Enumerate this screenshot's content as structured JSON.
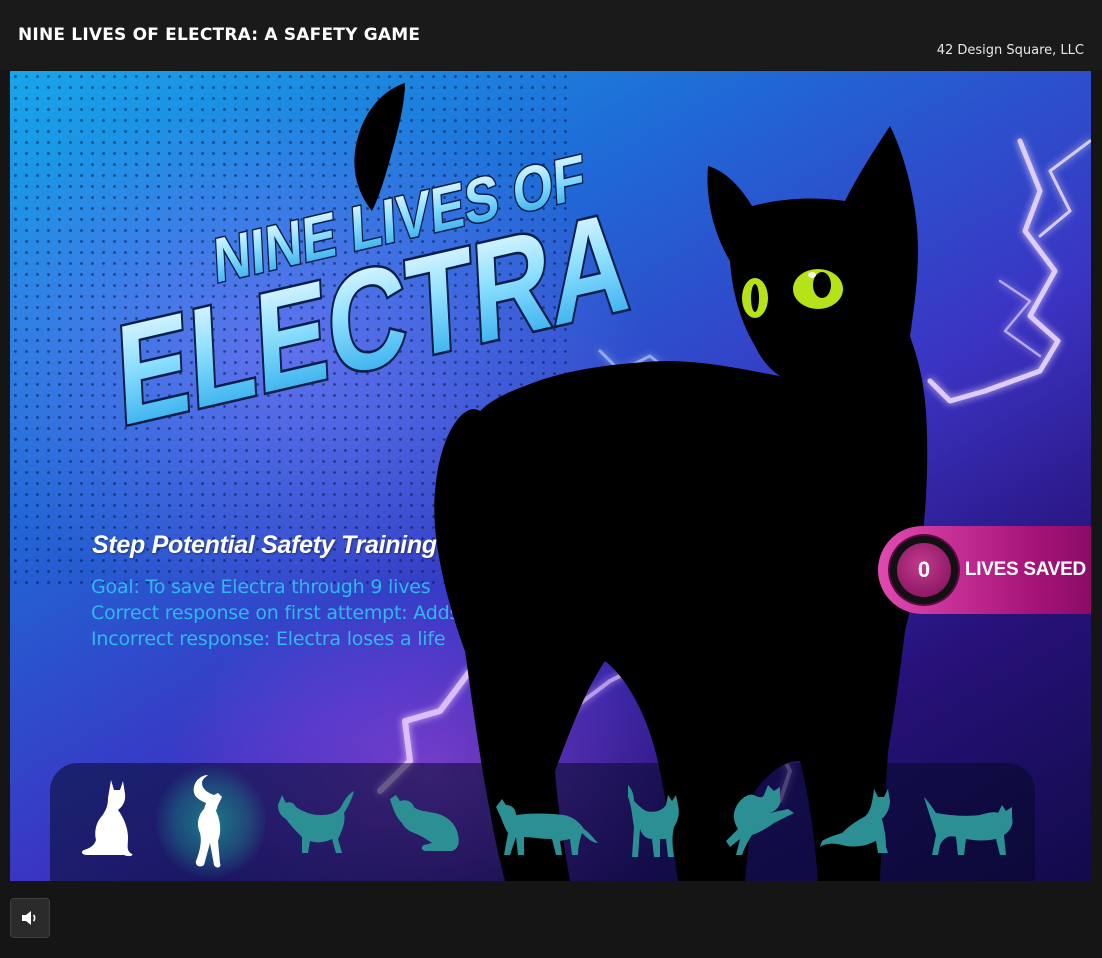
{
  "header": {
    "title": "NINE LIVES OF ELECTRA: A SAFETY GAME",
    "author": "42 Design Square, LLC"
  },
  "logo": {
    "line1": "NINE LIVES OF",
    "line2": "ELECTRA"
  },
  "intro": {
    "heading": "Step Potential Safety Training",
    "lines": [
      "Goal: To save Electra through 9 lives",
      "Correct response on first attempt: Adds to the credit balance",
      "Incorrect response: Electra loses a life"
    ]
  },
  "lives": {
    "count": "0",
    "label": "LIVES SAVED"
  },
  "life_tray": {
    "total": 9,
    "active_index": 1,
    "icons": [
      "cat-sitting-icon",
      "cat-walking-icon",
      "cat-stretching-icon",
      "cat-grooming-icon",
      "cat-prowling-icon",
      "cat-standing-icon",
      "cat-pouncing-icon",
      "cat-crouching-icon",
      "cat-strolling-icon"
    ]
  },
  "controls": {
    "volume_icon": "volume-icon"
  },
  "colors": {
    "accent_text": "#2fb9ee",
    "lives_badge": "#c22a8e",
    "tray_cat": "#2c8f93",
    "done_cat": "#ffffff",
    "active_glow": "#1c8a8e"
  }
}
